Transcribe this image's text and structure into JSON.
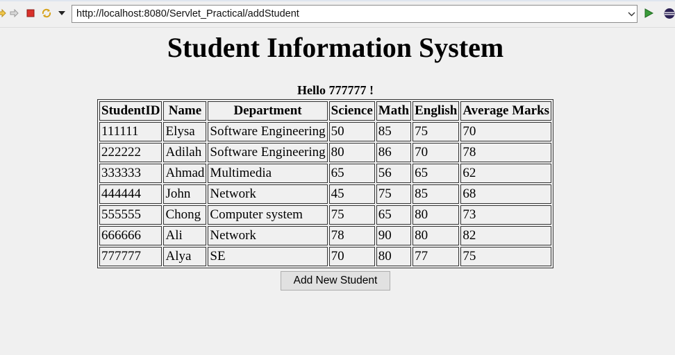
{
  "browser": {
    "url": "http://localhost:8080/Servlet_Practical/addStudent",
    "icons": [
      "back-arrow-icon",
      "forward-arrow-icon",
      "stop-icon",
      "refresh-icon",
      "menu-dropdown-icon",
      "address-dropdown-icon",
      "go-play-icon",
      "eclipse-icon"
    ],
    "colors": {
      "stop": "#d9302a",
      "go": "#3a9a3a"
    }
  },
  "page": {
    "title": "Student Information System",
    "greeting": "Hello 777777 !"
  },
  "table": {
    "headers": [
      "StudentID",
      "Name",
      "Department",
      "Science",
      "Math",
      "English",
      "Average Marks"
    ],
    "rows": [
      [
        "111111",
        "Elysa",
        "Software Engineering",
        "50",
        "85",
        "75",
        "70"
      ],
      [
        "222222",
        "Adilah",
        "Software Engineering",
        "80",
        "86",
        "70",
        "78"
      ],
      [
        "333333",
        "Ahmad",
        "Multimedia",
        "65",
        "56",
        "65",
        "62"
      ],
      [
        "444444",
        "John",
        "Network",
        "45",
        "75",
        "85",
        "68"
      ],
      [
        "555555",
        "Chong",
        "Computer system",
        "75",
        "65",
        "80",
        "73"
      ],
      [
        "666666",
        "Ali",
        "Network",
        "78",
        "90",
        "80",
        "82"
      ],
      [
        "777777",
        "Alya",
        "SE",
        "70",
        "80",
        "77",
        "75"
      ]
    ]
  },
  "actions": {
    "add_label": "Add New Student"
  }
}
